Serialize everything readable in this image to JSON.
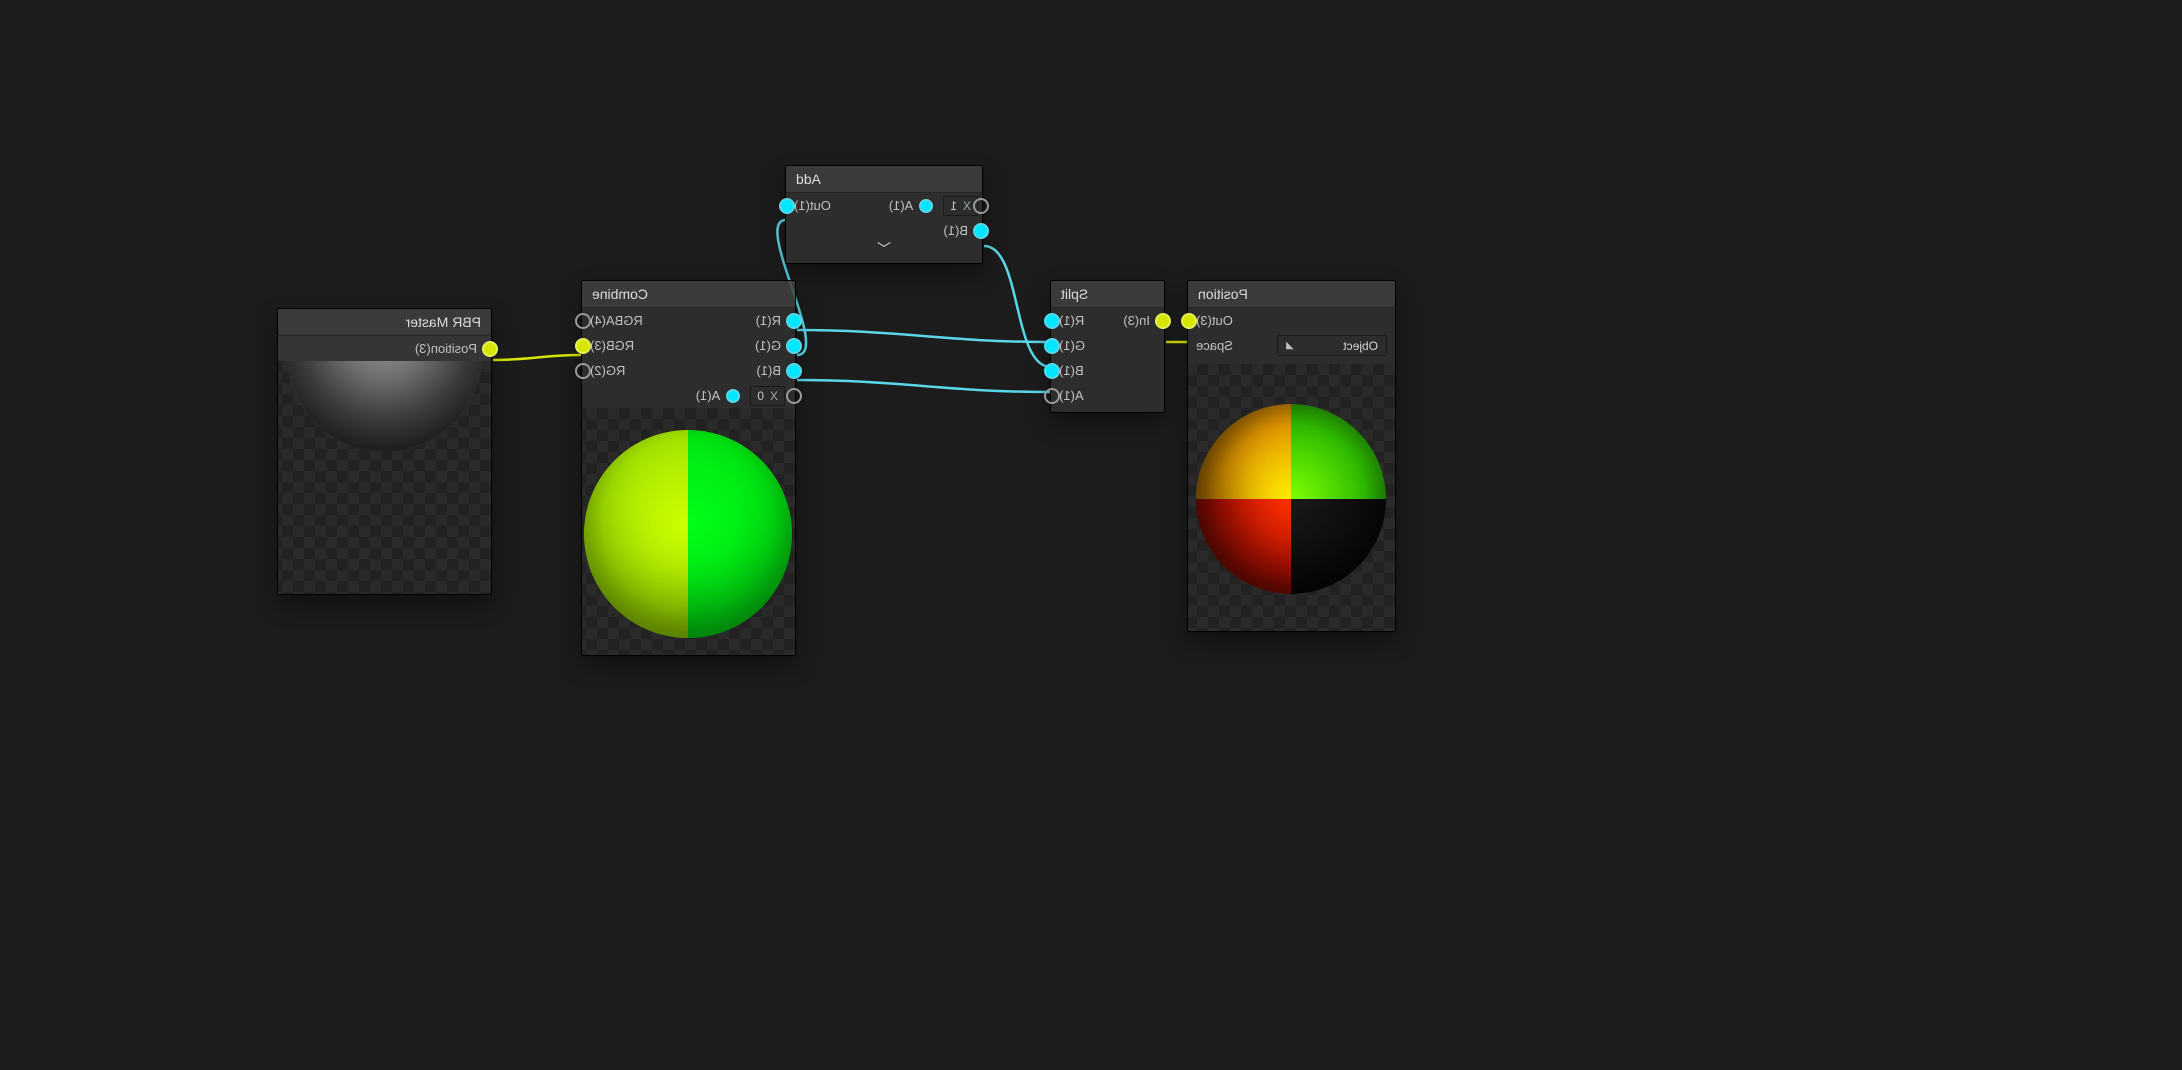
{
  "nodes": {
    "position": {
      "title": "Position",
      "outputs": {
        "out3": "Out(3)"
      },
      "params": {
        "space_label": "Space",
        "space_value": "Object"
      }
    },
    "split": {
      "title": "Split",
      "inputs": {
        "in3": "In(3)"
      },
      "outputs": {
        "r": "R(1)",
        "g": "G(1)",
        "b": "B(1)",
        "a": "A(1)"
      }
    },
    "add": {
      "title": "Add",
      "inputs": {
        "a": "A(1)",
        "b": "B(1)",
        "a_value_prefix": "X",
        "a_value": "1"
      },
      "outputs": {
        "out1": "Out(1)"
      }
    },
    "combine": {
      "title": "Combine",
      "inputs": {
        "r": "R(1)",
        "g": "G(1)",
        "b": "B(1)",
        "a": "A(1)",
        "a_value_prefix": "X",
        "a_value": "0"
      },
      "outputs": {
        "rgba4": "RGBA(4)",
        "rgb3": "RGB(3)",
        "rg2": "RG(2)"
      }
    },
    "pbr": {
      "title": "PBR Master",
      "inputs": {
        "position3": "Position(3)"
      }
    }
  },
  "wires": {
    "color_data": "#59d7e8",
    "color_vec3": "#d7e600"
  }
}
